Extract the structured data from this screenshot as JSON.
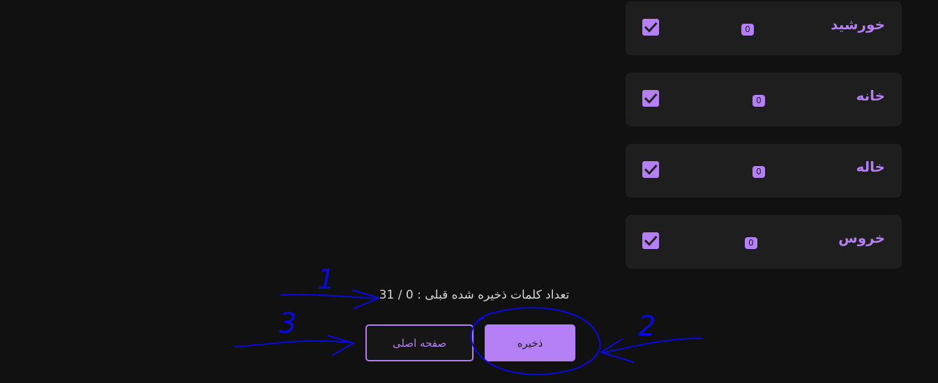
{
  "words": [
    {
      "label": "خورشید",
      "count": "0",
      "checked": true
    },
    {
      "label": "خانه",
      "count": "0",
      "checked": true
    },
    {
      "label": "خاله",
      "count": "0",
      "checked": true
    },
    {
      "label": "خروس",
      "count": "0",
      "checked": true
    }
  ],
  "footer": {
    "saved_count_text": "تعداد کلمات ذخیره شده قبلی : 0 / 31",
    "home_button_label": "صفحه اصلی",
    "save_button_label": "ذخیره"
  },
  "annotations": {
    "labels": [
      "1",
      "2",
      "3"
    ],
    "color": "#0a0ae0"
  },
  "colors": {
    "background": "#111111",
    "card": "#1e1e1e",
    "accent": "#b57ff5",
    "text": "#d8d8d8"
  },
  "icons": {
    "checkbox": "checkmark-icon"
  }
}
